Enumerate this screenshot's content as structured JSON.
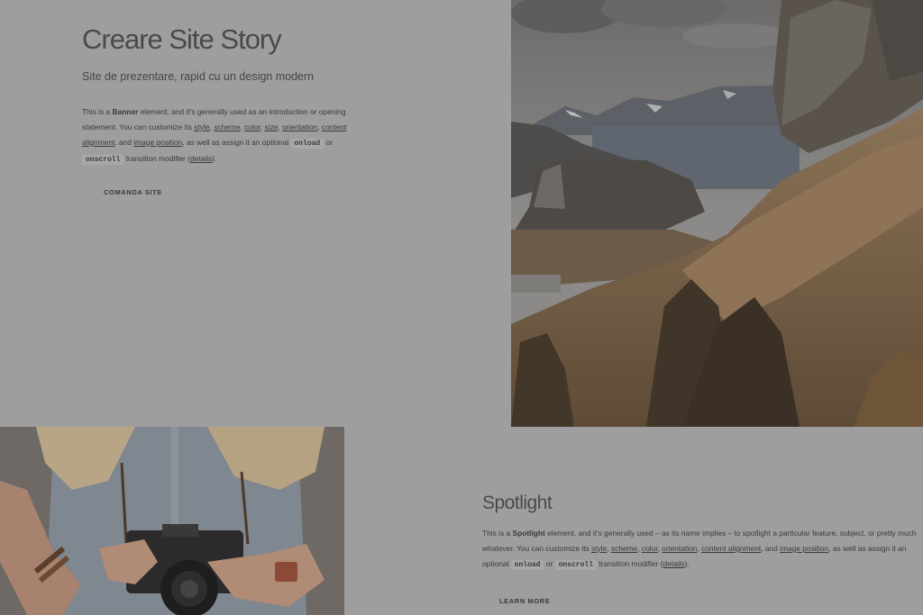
{
  "banner": {
    "title": "Creare Site Story",
    "subtitle": "Site de prezentare, rapid cu un design modern",
    "copy": {
      "t1": "This is a ",
      "strong": "Banner",
      "t2": " element, and it's generally used as an introduction or opening statement. You can customize its ",
      "link_style": "style",
      "link_scheme": "scheme",
      "link_color": "color",
      "link_size": "size",
      "link_orientation": "orientation",
      "link_content_alignment": "content alignment",
      "t3": ", and ",
      "link_image_position": "image position",
      "t4": ", as well as assign it an optional ",
      "code_onload": "onload",
      "t5": " or ",
      "code_onscroll": "onscroll",
      "t6": " transition modifier (",
      "link_details": "details",
      "t7": ")."
    },
    "button_label": "Comanda site"
  },
  "spotlight": {
    "title": "Spotlight",
    "copy": {
      "t1": "This is a ",
      "strong": "Spotlight",
      "t2": " element, and it's generally used – as its name implies – to spotlight a particular feature, subject, or pretty much whatever. You can customize its ",
      "link_style": "style",
      "link_scheme": "scheme",
      "link_color": "color",
      "link_orientation": "orientation",
      "link_content_alignment": "content alignment",
      "t3": ", and ",
      "link_image_position": "image position",
      "t4": ", as well as assign it an optional ",
      "code_onload": "onload",
      "t5": " or ",
      "code_onscroll": "onscroll",
      "t6": " transition modifier (",
      "link_details": "details",
      "t7": ")."
    },
    "button_label": "Learn More"
  },
  "colors": {
    "overlay_background": "#9e9e9e",
    "text": "#3e3e3e"
  }
}
